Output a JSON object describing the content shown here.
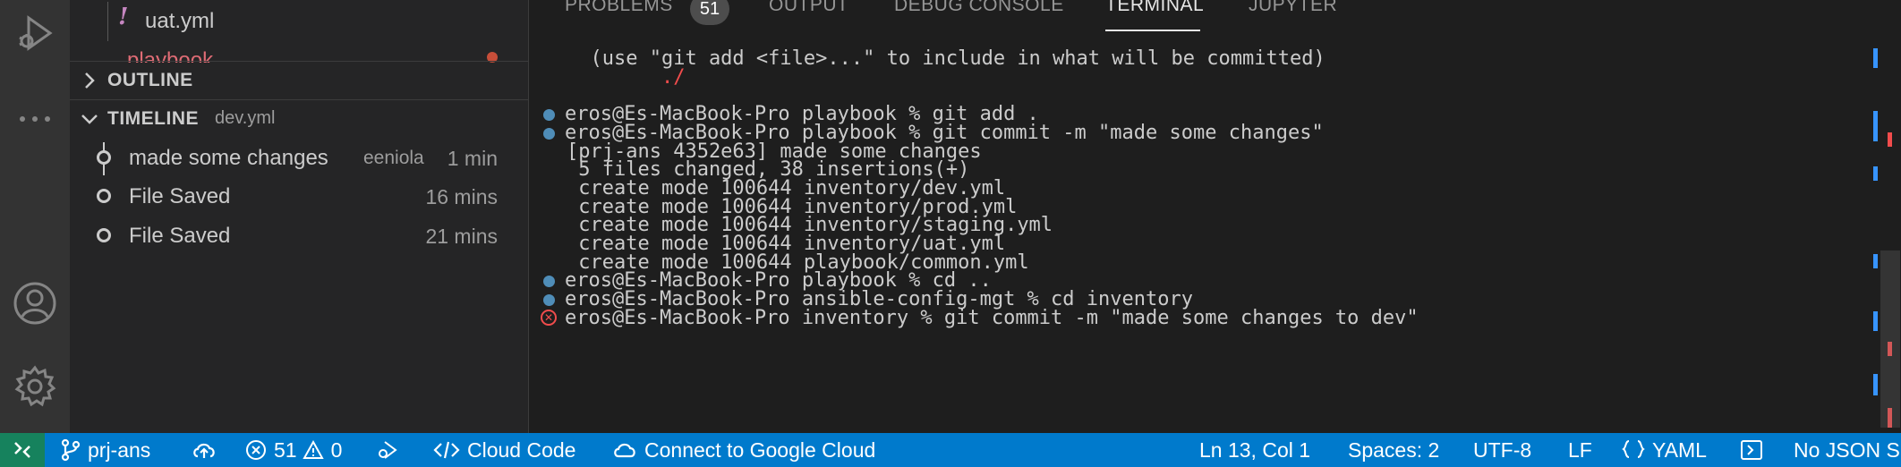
{
  "sidebar": {
    "file_item": {
      "name": "uat.yml",
      "icon": "yaml-exclamation-icon"
    },
    "cut_item": {
      "name": "playbook"
    },
    "outline": {
      "title": "OUTLINE"
    },
    "timeline": {
      "title": "TIMELINE",
      "file": "dev.yml",
      "items": [
        {
          "label": "made some changes",
          "author": "eeniola",
          "time": "1 min"
        },
        {
          "label": "File Saved",
          "author": "",
          "time": "16 mins"
        },
        {
          "label": "File Saved",
          "author": "",
          "time": "21 mins"
        }
      ]
    }
  },
  "panel": {
    "tabs": [
      {
        "label": "PROBLEMS",
        "badge": "51"
      },
      {
        "label": "OUTPUT"
      },
      {
        "label": "DEBUG CONSOLE"
      },
      {
        "label": "TERMINAL",
        "active": true
      },
      {
        "label": "JUPYTER"
      }
    ],
    "terminal": {
      "lines": [
        {
          "text": "  (use \"git add <file>...\" to include in what will be committed)",
          "mark": "",
          "color": ""
        },
        {
          "text": "        ./",
          "mark": "",
          "color": "red"
        },
        {
          "text": "",
          "mark": "",
          "color": ""
        },
        {
          "text": "eros@Es-MacBook-Pro playbook % git add .",
          "mark": "dot",
          "color": ""
        },
        {
          "text": "eros@Es-MacBook-Pro playbook % git commit -m \"made some changes\"",
          "mark": "dot",
          "color": ""
        },
        {
          "text": "[prj-ans 4352e63] made some changes",
          "mark": "",
          "color": ""
        },
        {
          "text": " 5 files changed, 38 insertions(+)",
          "mark": "",
          "color": ""
        },
        {
          "text": " create mode 100644 inventory/dev.yml",
          "mark": "",
          "color": ""
        },
        {
          "text": " create mode 100644 inventory/prod.yml",
          "mark": "",
          "color": ""
        },
        {
          "text": " create mode 100644 inventory/staging.yml",
          "mark": "",
          "color": ""
        },
        {
          "text": " create mode 100644 inventory/uat.yml",
          "mark": "",
          "color": ""
        },
        {
          "text": " create mode 100644 playbook/common.yml",
          "mark": "",
          "color": ""
        },
        {
          "text": "eros@Es-MacBook-Pro playbook % cd ..",
          "mark": "dot",
          "color": ""
        },
        {
          "text": "eros@Es-MacBook-Pro ansible-config-mgt % cd inventory",
          "mark": "dot",
          "color": ""
        },
        {
          "text": "eros@Es-MacBook-Pro inventory % git commit -m \"made some changes to dev\"",
          "mark": "error",
          "color": ""
        }
      ]
    }
  },
  "statusbar": {
    "branch": "prj-ans",
    "errors": "51",
    "warnings": "0",
    "cloud_code": "Cloud Code",
    "google_cloud": "Connect to Google Cloud",
    "position": "Ln 13, Col 1",
    "spaces": "Spaces: 2",
    "encoding": "UTF-8",
    "eol": "LF",
    "language": "YAML",
    "schema": "No JSON S"
  },
  "colors": {
    "statusbar": "#007acc",
    "remote": "#16825d",
    "activity_bar": "#333333",
    "sidebar": "#252526",
    "editor": "#1e1e1e",
    "prompt_dot": "#4f8db8",
    "error": "#f14c4c"
  }
}
